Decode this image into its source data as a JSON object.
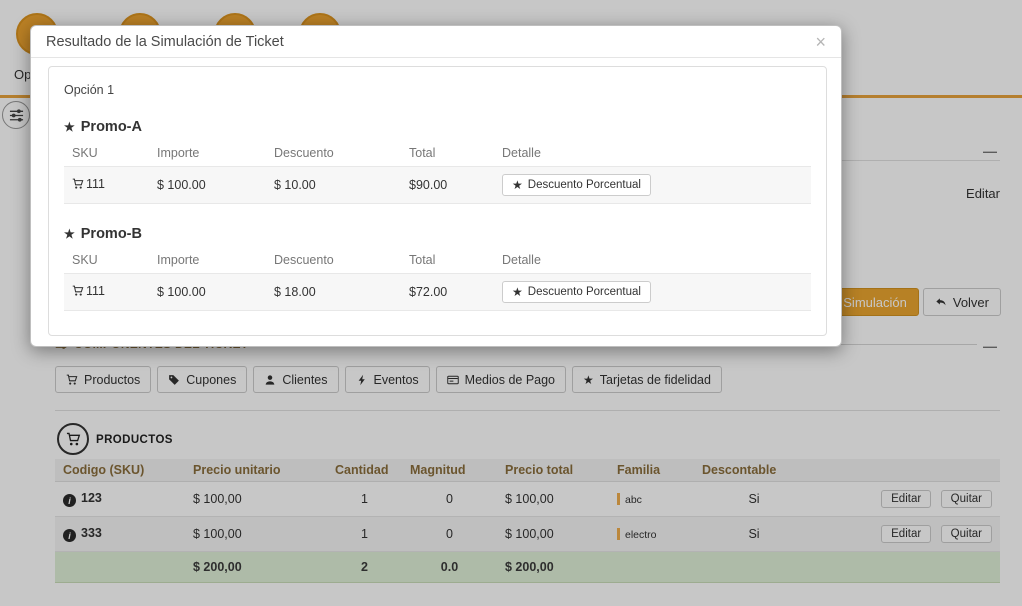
{
  "modal": {
    "title": "Resultado de la Simulación de Ticket",
    "close_glyph": "×",
    "option_label": "Opción 1",
    "table_headers": [
      "SKU",
      "Importe",
      "Descuento",
      "Total",
      "Detalle"
    ],
    "promos": [
      {
        "name": "Promo-A",
        "rows": [
          {
            "sku": "111",
            "importe": "$ 100.00",
            "descuento": "$ 10.00",
            "total": "$90.00",
            "detalle": "Descuento Porcentual"
          }
        ]
      },
      {
        "name": "Promo-B",
        "rows": [
          {
            "sku": "111",
            "importe": "$ 100.00",
            "descuento": "$ 18.00",
            "total": "$72.00",
            "detalle": "Descuento Porcentual"
          }
        ]
      }
    ]
  },
  "background": {
    "steps_label": "Opciones",
    "collapse_glyph": "—",
    "editar_link": "Editar",
    "simulacion_button": "Simulación",
    "volver_button": "Volver",
    "components_header": "COMPONENTES DEL TICKET",
    "tabs": [
      "Productos",
      "Cupones",
      "Clientes",
      "Eventos",
      "Medios de Pago",
      "Tarjetas de fidelidad"
    ],
    "products_title": "PRODUCTOS",
    "products_table": {
      "headers": [
        "Codigo (SKU)",
        "Precio unitario",
        "Cantidad",
        "Magnitud",
        "Precio total",
        "Familia",
        "Descontable"
      ],
      "rows": [
        {
          "sku": "123",
          "precio_unitario": "$ 100,00",
          "cantidad": "1",
          "magnitud": "0",
          "precio_total": "$ 100,00",
          "familia": "abc",
          "descontable": "Si"
        },
        {
          "sku": "333",
          "precio_unitario": "$ 100,00",
          "cantidad": "1",
          "magnitud": "0",
          "precio_total": "$ 100,00",
          "familia": "electro",
          "descontable": "Si"
        }
      ],
      "edit_label": "Editar",
      "remove_label": "Quitar",
      "totals": {
        "precio_unitario": "$ 200,00",
        "cantidad": "2",
        "magnitud": "0.0",
        "precio_total": "$ 200,00"
      }
    }
  },
  "colors": {
    "accent_orange": "#e8a33d",
    "warning_button": "#eba630",
    "success_total_row": "#dff0d8",
    "table_header_text": "#8a6d3b",
    "family_bar": "#f0ad4e"
  }
}
